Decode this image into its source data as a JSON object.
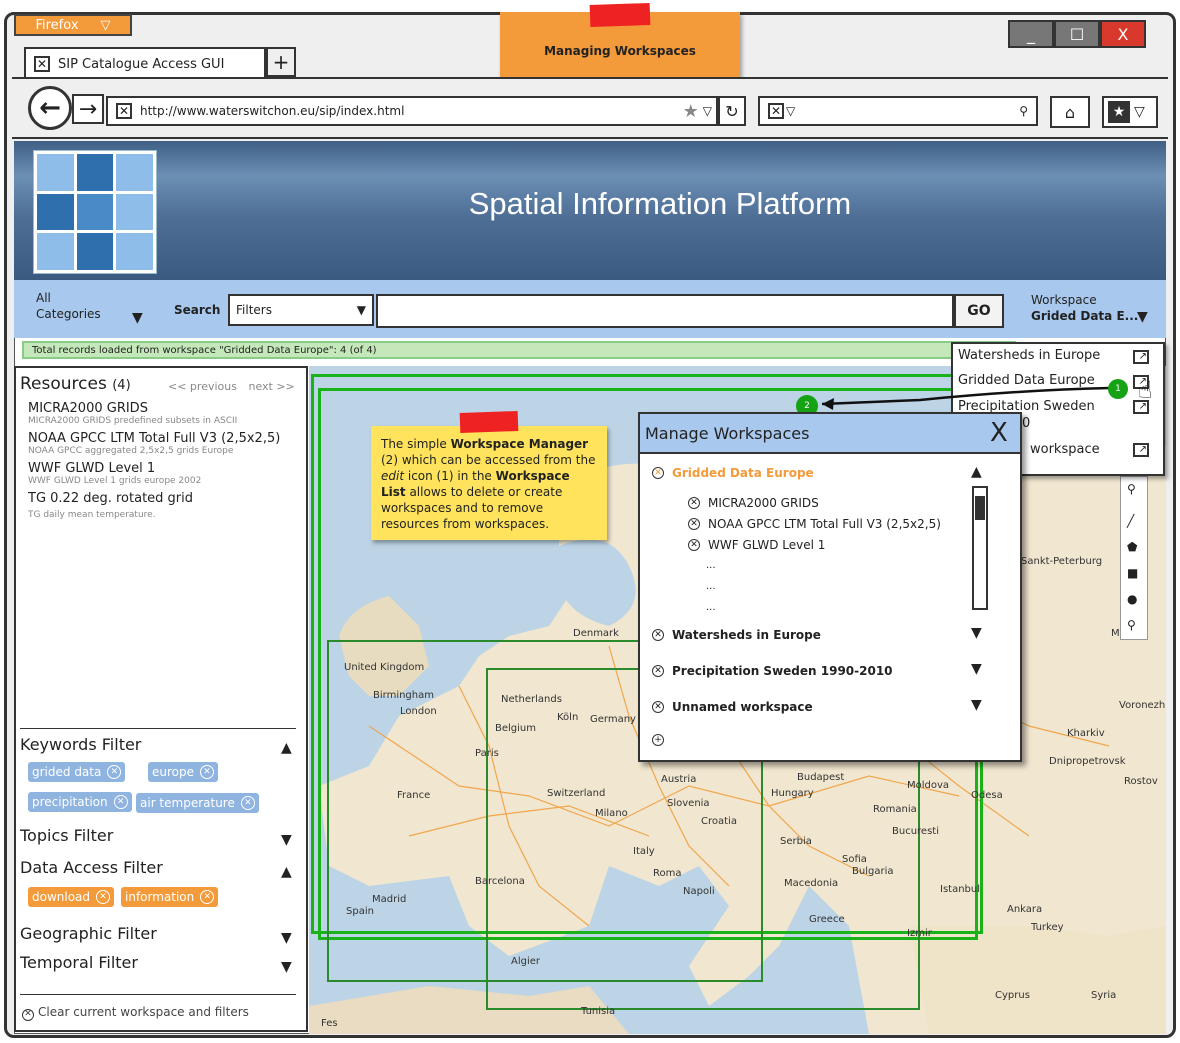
{
  "sticky_title": "Managing Workspaces",
  "browser": {
    "firefox_label": "Firefox",
    "tab_title": "SIP Catalogue Access GUI",
    "url": "http://www.waterswitchon.eu/sip/index.html",
    "window_controls": [
      "_",
      "☐",
      "X"
    ]
  },
  "header": {
    "title": "Spatial Information Platform"
  },
  "toolbar": {
    "categories_line1": "All",
    "categories_line2": "Categories",
    "search_label": "Search",
    "filters_value": "Filters",
    "search_value": "",
    "go_label": "GO",
    "workspace_label": "Workspace",
    "workspace_value": "Grided Data E..."
  },
  "status_text": "Total records loaded from workspace \"Gridded Data Europe\": 4 (of 4)",
  "resources": {
    "title": "Resources",
    "count": "(4)",
    "previous": "<< previous",
    "next": "next >>",
    "items": [
      {
        "name": "MICRA2000 GRIDS",
        "desc": "MICRA2000 GRIDS predefined subsets in ASCII"
      },
      {
        "name": "NOAA GPCC LTM Total Full V3 (2,5x2,5)",
        "desc": "NOAA GPCC aggregated 2,5x2,5 grids Europe"
      },
      {
        "name": "WWF GLWD Level 1",
        "desc": "WWF GLWD Level 1 grids europe 2002"
      },
      {
        "name": "TG 0.22 deg. rotated grid",
        "desc": "TG daily mean temperature."
      }
    ]
  },
  "filters": {
    "keywords_title": "Keywords Filter",
    "keywords_tags": [
      "grided data",
      "europe",
      "precipitation",
      "air temperature"
    ],
    "topics_title": "Topics Filter",
    "data_access_title": "Data Access Filter",
    "data_access_tags": [
      "download",
      "information"
    ],
    "geographic_title": "Geographic Filter",
    "temporal_title": "Temporal Filter",
    "clear_label": "Clear current workspace and filters"
  },
  "note": {
    "t1": "The simple ",
    "b1": "Workspace Manager",
    "t2": " (2) which can be accessed from the ",
    "i1": "edit",
    "t3": " icon (1) in the ",
    "b2": "Workspace List",
    "t4": " allows to delete or create workspaces and to remove resources from workspaces."
  },
  "workspace_dropdown": {
    "items": [
      "Watersheds in Europe",
      "Gridded Data Europe",
      "Precipitation Sweden",
      "workspace"
    ],
    "partial_char": "0"
  },
  "badges": {
    "one": "1",
    "two": "2"
  },
  "modal": {
    "title": "Manage Workspaces",
    "close": "X",
    "active_workspace": "Gridded Data Europe",
    "active_items": [
      "MICRA2000 GRIDS",
      "NOAA GPCC LTM Total Full V3 (2,5x2,5)",
      "WWF GLWD Level 1"
    ],
    "ellipsis": [
      "...",
      "...",
      "..."
    ],
    "workspaces": [
      "Watersheds in Europe",
      "Precipitation Sweden 1990-2010",
      "Unnamed workspace"
    ]
  },
  "map": {
    "places": [
      "Denmark",
      "United Kingdom",
      "Birmingham",
      "London",
      "Netherlands",
      "Belgium",
      "Köln",
      "Germany",
      "Paris",
      "France",
      "Switzerland",
      "Milano",
      "Austria",
      "Slovenia",
      "Croatia",
      "Italy",
      "Roma",
      "Napoli",
      "Barcelona",
      "Madrid",
      "Spain",
      "Hungary",
      "Budapest",
      "Romania",
      "Bucuresti",
      "Serbia",
      "Sofia",
      "Bulgaria",
      "Macedonia",
      "Greece",
      "Turkey",
      "Ankara",
      "Istanbul",
      "Izmir",
      "Moldova",
      "Odesa",
      "Kharkiv",
      "Voronezh",
      "Moskva",
      "Rostov",
      "Dnipropetrovsk",
      "Algier",
      "Tunisia",
      "Cyprus",
      "Syria",
      "Fes",
      "Sankt-Peterburg"
    ]
  },
  "colors": {
    "accent_blue": "#a9c8ee",
    "sticky_orange": "#f39a3a",
    "note_yellow": "#ffe35c",
    "status_green": "#c4e8b9",
    "box_green": "#2b8a2b"
  }
}
